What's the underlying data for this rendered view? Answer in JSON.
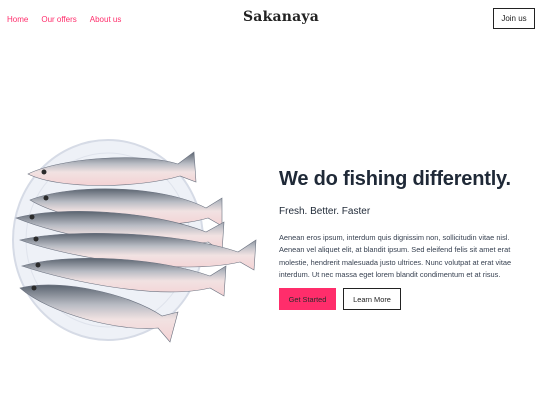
{
  "nav": {
    "links": [
      "Home",
      "Our offers",
      "About us"
    ],
    "brand": "Sakanaya",
    "join_label": "Join us"
  },
  "hero": {
    "title": "We do fishing differently.",
    "subtitle": "Fresh. Better. Faster",
    "body": "Aenean eros ipsum, interdum quis dignissim non, sollicitudin vitae nisl. Aenean vel aliquet elit, at blandit ipsum. Sed eleifend felis sit amet erat molestie, hendrerit malesuada justo ultrices. Nunc volutpat at erat vitae interdum. Ut nec massa eget lorem blandit condimentum et at risus.",
    "primary_label": "Get Started",
    "secondary_label": "Learn More"
  },
  "image": {
    "name": "fish-on-plate-image"
  },
  "colors": {
    "accent": "#ff2d6b",
    "text": "#1f2937"
  }
}
